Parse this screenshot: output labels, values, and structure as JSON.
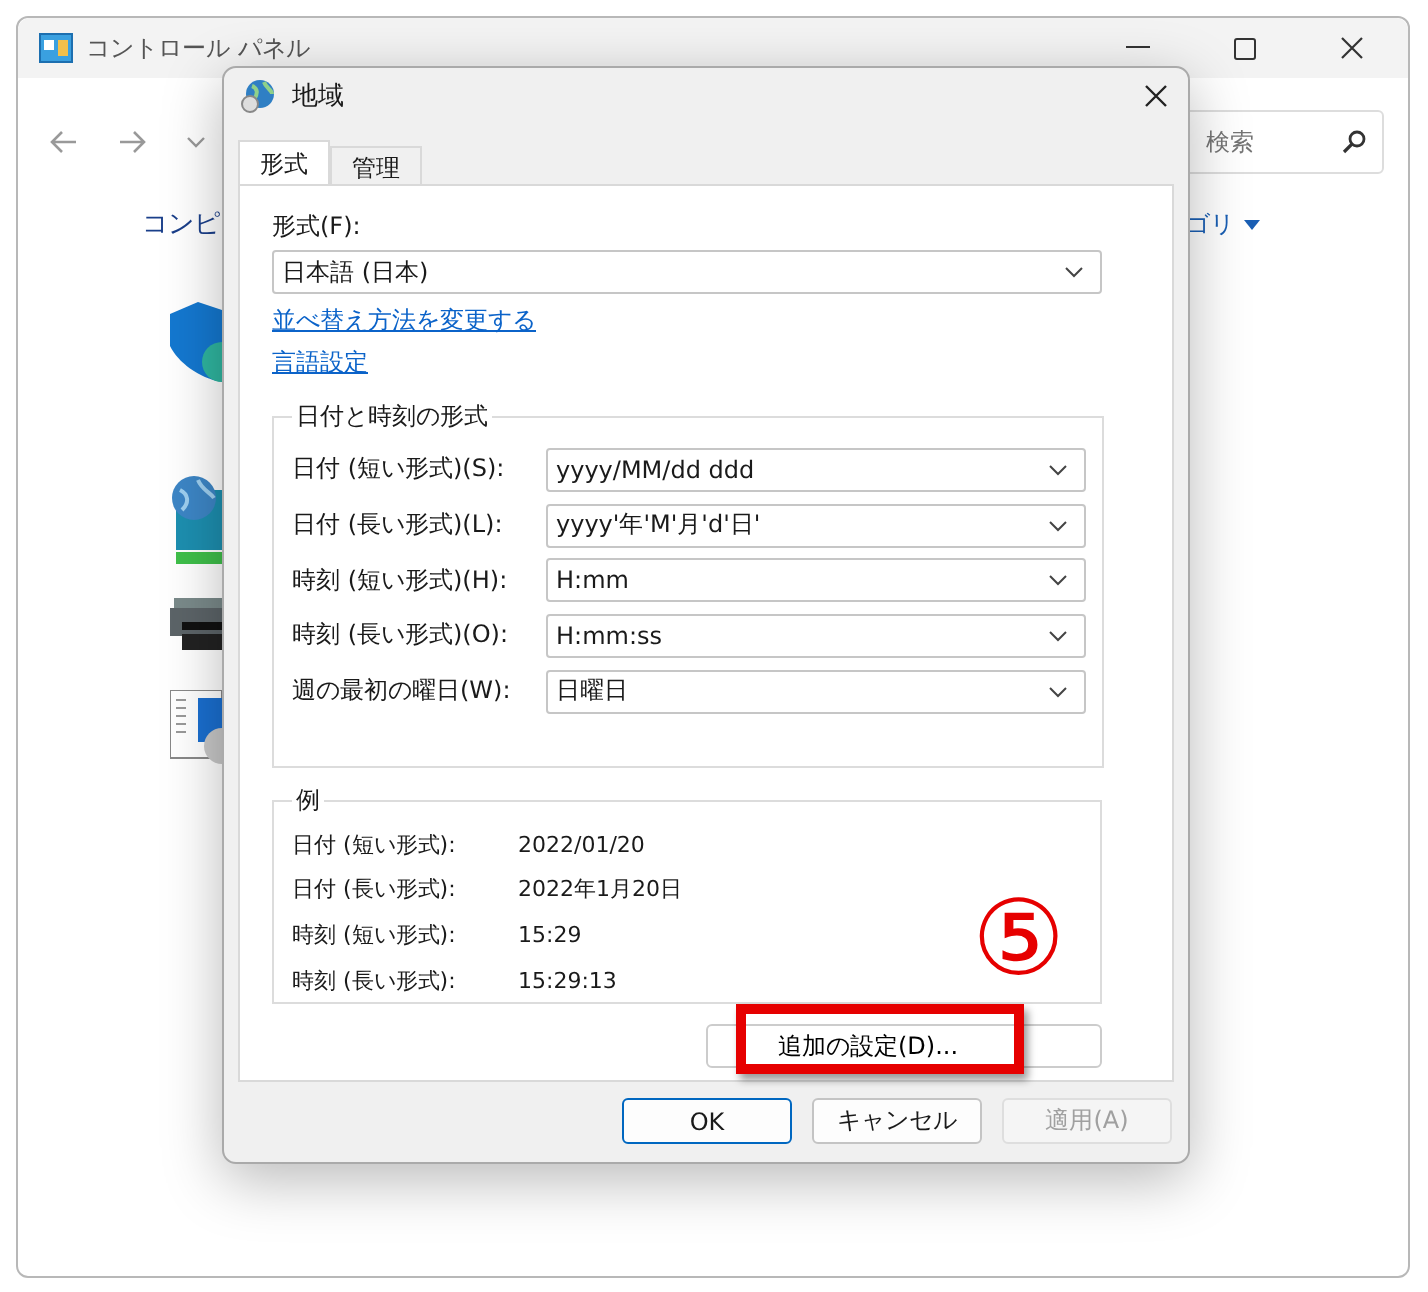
{
  "background_window": {
    "title": "コントロール パネル",
    "search": {
      "placeholder": "検索"
    },
    "heading_fragment": "コンピ",
    "view_fragment": "ゴリ"
  },
  "dialog": {
    "title": "地域",
    "tabs": [
      {
        "label": "形式",
        "selected": true
      },
      {
        "label": "管理",
        "selected": false
      }
    ],
    "format_label": "形式(F):",
    "format_value": "日本語 (日本)",
    "links": [
      "並べ替え方法を変更する",
      "言語設定"
    ],
    "datetime_group": {
      "title": "日付と時刻の形式",
      "rows": [
        {
          "label": "日付 (短い形式)(S):",
          "value": "yyyy/MM/dd ddd"
        },
        {
          "label": "日付 (長い形式)(L):",
          "value": "yyyy'年'M'月'd'日'"
        },
        {
          "label": "時刻 (短い形式)(H):",
          "value": "H:mm"
        },
        {
          "label": "時刻 (長い形式)(O):",
          "value": "H:mm:ss"
        },
        {
          "label": "週の最初の曜日(W):",
          "value": "日曜日"
        }
      ]
    },
    "example_group": {
      "title": "例",
      "rows": [
        {
          "label": "日付 (短い形式):",
          "value": "2022/01/20"
        },
        {
          "label": "日付 (長い形式):",
          "value": "2022年1月20日"
        },
        {
          "label": "時刻 (短い形式):",
          "value": "15:29"
        },
        {
          "label": "時刻 (長い形式):",
          "value": "15:29:13"
        }
      ]
    },
    "additional_button": "追加の設定(D)...",
    "buttons": [
      {
        "label": "OK",
        "kind": "default",
        "disabled": false
      },
      {
        "label": "キャンセル",
        "kind": "normal",
        "disabled": false
      },
      {
        "label": "適用(A)",
        "kind": "normal",
        "disabled": true
      }
    ]
  },
  "annotation": {
    "marker": "⑤"
  }
}
